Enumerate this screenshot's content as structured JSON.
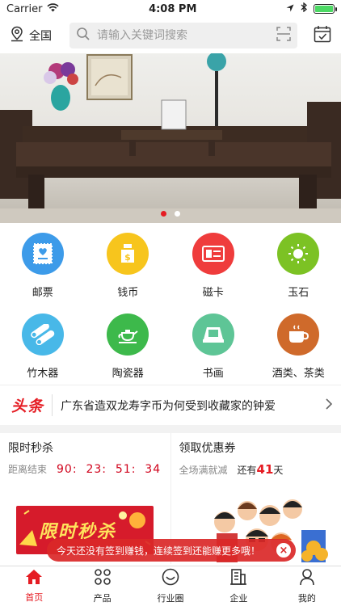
{
  "status_bar": {
    "carrier": "Carrier",
    "time": "4:08 PM"
  },
  "top_bar": {
    "region_label": "全国",
    "search_placeholder": "请输入关键词搜索"
  },
  "banner": {
    "slide_count": 2,
    "active_slide": 1
  },
  "categories": [
    {
      "label": "邮票",
      "icon": "stamp-icon",
      "color": "#3d9be9"
    },
    {
      "label": "钱币",
      "icon": "money-bag-icon",
      "color": "#f7c51d"
    },
    {
      "label": "磁卡",
      "icon": "card-icon",
      "color": "#ef3c3c"
    },
    {
      "label": "玉石",
      "icon": "jade-icon",
      "color": "#7cc224"
    },
    {
      "label": "竹木器",
      "icon": "bamboo-icon",
      "color": "#48b8e8"
    },
    {
      "label": "陶瓷器",
      "icon": "teapot-icon",
      "color": "#3db94b"
    },
    {
      "label": "书画",
      "icon": "scroll-icon",
      "color": "#5ec596"
    },
    {
      "label": "酒类、茶类",
      "icon": "tea-cup-icon",
      "color": "#cf6a2b"
    }
  ],
  "headline": {
    "tag": "头条",
    "text": "广东省造双龙寿字币为何受到收藏家的钟爱"
  },
  "flash_sale": {
    "title": "限时秒杀",
    "countdown_label": "距离结束",
    "countdown": "90:  23:  51:  34",
    "banner_text": "限时秒杀"
  },
  "coupon": {
    "title": "领取优惠券",
    "subtitle": "全场满就减",
    "remain_prefix": "还有",
    "remain_days": "41",
    "remain_suffix": "天"
  },
  "toast": {
    "message": "今天还没有签到赚钱，连续签到还能赚更多哦！",
    "color": "#da2828"
  },
  "tabs": [
    {
      "label": "首页",
      "icon": "home-icon",
      "active": true
    },
    {
      "label": "产品",
      "icon": "grid-icon",
      "active": false
    },
    {
      "label": "行业圈",
      "icon": "circle-smile-icon",
      "active": false
    },
    {
      "label": "企业",
      "icon": "building-icon",
      "active": false
    },
    {
      "label": "我的",
      "icon": "person-icon",
      "active": false
    }
  ],
  "accent_color": "#e51c23"
}
